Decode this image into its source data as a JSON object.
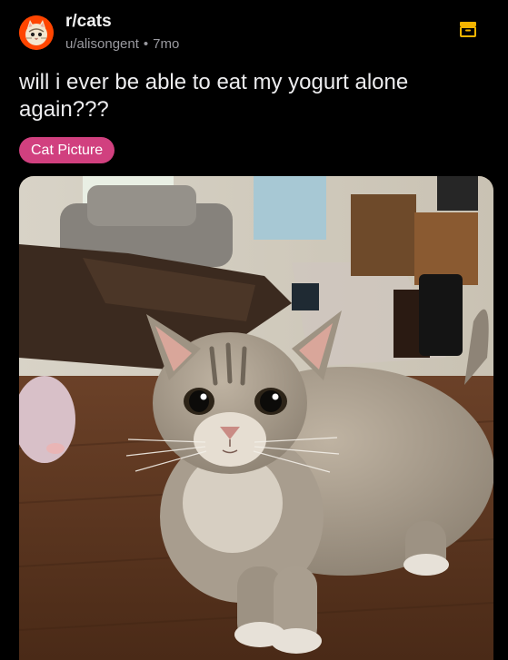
{
  "post": {
    "subreddit": "r/cats",
    "author": "u/alisongent",
    "separator": "•",
    "age": "7mo",
    "title": "will i ever be able to eat my yogurt alone again???",
    "flair": "Cat Picture",
    "image_alt": "kitten photo"
  },
  "icons": {
    "subreddit_avatar": "cat-avatar-icon",
    "archive": "archive-icon"
  },
  "colors": {
    "background": "#000000",
    "flair": "#d1407f",
    "archive_icon": "#f5b400",
    "avatar": "#ff4500"
  }
}
